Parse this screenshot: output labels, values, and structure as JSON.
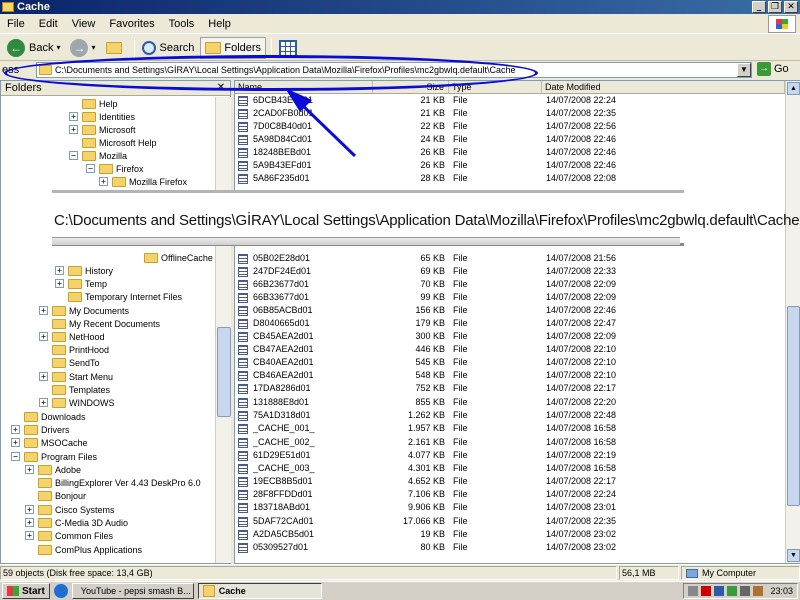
{
  "window": {
    "title": "Cache"
  },
  "menu": [
    "File",
    "Edit",
    "View",
    "Favorites",
    "Tools",
    "Help"
  ],
  "toolbar": {
    "back": "Back",
    "search": "Search",
    "folders": "Folders"
  },
  "address": {
    "label": "ess",
    "path": "C:\\Documents and Settings\\GİRAY\\Local Settings\\Application Data\\Mozilla\\Firefox\\Profiles\\mc2gbwlq.default\\Cache",
    "go": "Go"
  },
  "folders_pane": {
    "title": "Folders",
    "tree": [
      {
        "label": "Help",
        "exp": ""
      },
      {
        "label": "Identities",
        "exp": "+"
      },
      {
        "label": "Microsoft",
        "exp": "+"
      },
      {
        "label": "Microsoft Help",
        "exp": ""
      },
      {
        "label": "Mozilla",
        "exp": "−"
      },
      {
        "label": "Firefox",
        "exp": "−"
      },
      {
        "label": "Mozilla Firefox",
        "exp": "+"
      },
      {
        "label": "OfflineCache",
        "exp": ""
      },
      {
        "label": "History",
        "exp": "+"
      },
      {
        "label": "Temp",
        "exp": "+"
      },
      {
        "label": "Temporary Internet Files",
        "exp": ""
      },
      {
        "label": "My Documents",
        "exp": "+"
      },
      {
        "label": "My Recent Documents",
        "exp": ""
      },
      {
        "label": "NetHood",
        "exp": "+"
      },
      {
        "label": "PrintHood",
        "exp": ""
      },
      {
        "label": "SendTo",
        "exp": ""
      },
      {
        "label": "Start Menu",
        "exp": "+"
      },
      {
        "label": "Templates",
        "exp": ""
      },
      {
        "label": "WINDOWS",
        "exp": "+"
      },
      {
        "label": "Downloads",
        "exp": ""
      },
      {
        "label": "Drivers",
        "exp": "+"
      },
      {
        "label": "MSOCache",
        "exp": "+"
      },
      {
        "label": "Program Files",
        "exp": "−"
      },
      {
        "label": "Adobe",
        "exp": "+"
      },
      {
        "label": "BillingExplorer Ver 4.43 DeskPro 6.0",
        "exp": ""
      },
      {
        "label": "Bonjour",
        "exp": ""
      },
      {
        "label": "Cisco Systems",
        "exp": "+"
      },
      {
        "label": "C-Media 3D Audio",
        "exp": "+"
      },
      {
        "label": "Common Files",
        "exp": "+"
      },
      {
        "label": "ComPlus Applications",
        "exp": ""
      }
    ]
  },
  "file_list": {
    "columns": [
      "Name",
      "Size",
      "Type",
      "Date Modified"
    ],
    "rows": [
      {
        "name": "6DCB43E5d01",
        "size": "21 KB",
        "type": "File",
        "date": "14/07/2008 22:24"
      },
      {
        "name": "2CAD0FB0d01",
        "size": "21 KB",
        "type": "File",
        "date": "14/07/2008 22:35"
      },
      {
        "name": "7D0C8B40d01",
        "size": "22 KB",
        "type": "File",
        "date": "14/07/2008 22:56"
      },
      {
        "name": "5A98D84Cd01",
        "size": "24 KB",
        "type": "File",
        "date": "14/07/2008 22:46"
      },
      {
        "name": "18248BEBd01",
        "size": "26 KB",
        "type": "File",
        "date": "14/07/2008 22:46"
      },
      {
        "name": "5A9B43EFd01",
        "size": "26 KB",
        "type": "File",
        "date": "14/07/2008 22:46"
      },
      {
        "name": "5A86F235d01",
        "size": "28 KB",
        "type": "File",
        "date": "14/07/2008 22:08"
      },
      {
        "name": "05B02E28d01",
        "size": "65 KB",
        "type": "File",
        "date": "14/07/2008 21:56"
      },
      {
        "name": "247DF24Ed01",
        "size": "69 KB",
        "type": "File",
        "date": "14/07/2008 22:33"
      },
      {
        "name": "66B23677d01",
        "size": "70 KB",
        "type": "File",
        "date": "14/07/2008 22:09"
      },
      {
        "name": "66B33677d01",
        "size": "99 KB",
        "type": "File",
        "date": "14/07/2008 22:09"
      },
      {
        "name": "06B85ACBd01",
        "size": "156 KB",
        "type": "File",
        "date": "14/07/2008 22:46"
      },
      {
        "name": "D8040665d01",
        "size": "179 KB",
        "type": "File",
        "date": "14/07/2008 22:47"
      },
      {
        "name": "CB45AEA2d01",
        "size": "300 KB",
        "type": "File",
        "date": "14/07/2008 22:09"
      },
      {
        "name": "CB47AEA2d01",
        "size": "446 KB",
        "type": "File",
        "date": "14/07/2008 22:10"
      },
      {
        "name": "CB40AEA2d01",
        "size": "545 KB",
        "type": "File",
        "date": "14/07/2008 22:10"
      },
      {
        "name": "CB46AEA2d01",
        "size": "548 KB",
        "type": "File",
        "date": "14/07/2008 22:10"
      },
      {
        "name": "17DA8286d01",
        "size": "752 KB",
        "type": "File",
        "date": "14/07/2008 22:17"
      },
      {
        "name": "131888E8d01",
        "size": "855 KB",
        "type": "File",
        "date": "14/07/2008 22:20"
      },
      {
        "name": "75A1D318d01",
        "size": "1.262 KB",
        "type": "File",
        "date": "14/07/2008 22:48"
      },
      {
        "name": "_CACHE_001_",
        "size": "1.957 KB",
        "type": "File",
        "date": "14/07/2008 16:58"
      },
      {
        "name": "_CACHE_002_",
        "size": "2.161 KB",
        "type": "File",
        "date": "14/07/2008 16:58"
      },
      {
        "name": "61D29E51d01",
        "size": "4.077 KB",
        "type": "File",
        "date": "14/07/2008 22:19"
      },
      {
        "name": "_CACHE_003_",
        "size": "4.301 KB",
        "type": "File",
        "date": "14/07/2008 16:58"
      },
      {
        "name": "19ECB8B5d01",
        "size": "4.652 KB",
        "type": "File",
        "date": "14/07/2008 22:17"
      },
      {
        "name": "28F8FFDDd01",
        "size": "7.106 KB",
        "type": "File",
        "date": "14/07/2008 22:24"
      },
      {
        "name": "183718ABd01",
        "size": "9.906 KB",
        "type": "File",
        "date": "14/07/2008 23:01"
      },
      {
        "name": "5DAF72CAd01",
        "size": "17.066 KB",
        "type": "File",
        "date": "14/07/2008 22:35"
      },
      {
        "name": "A2DA5CB5d01",
        "size": "19 KB",
        "type": "File",
        "date": "14/07/2008 23:02"
      },
      {
        "name": "05309527d01",
        "size": "80 KB",
        "type": "File",
        "date": "14/07/2008 23:02"
      }
    ]
  },
  "zoom_overlay": {
    "text": "C:\\Documents and Settings\\GİRAY\\Local Settings\\Application Data\\Mozilla\\Firefox\\Profiles\\mc2gbwlq.default\\Cache"
  },
  "status": {
    "objects": "59 objects (Disk free space: 13,4 GB)",
    "size": "56,1 MB",
    "location": "My Computer"
  },
  "taskbar": {
    "start": "Start",
    "tasks": [
      {
        "label": "YouTube - pepsi smash B..."
      },
      {
        "label": "Cache"
      }
    ],
    "clock": "23:03"
  },
  "colors": {
    "annotation_blue": "#0B0BD8",
    "title_bar": "#0A246A"
  },
  "icons": [
    "folder-icon",
    "back-arrow-icon",
    "forward-arrow-icon",
    "up-folder-icon",
    "search-icon",
    "views-icon",
    "go-arrow-icon",
    "file-icon",
    "my-computer-icon"
  ]
}
